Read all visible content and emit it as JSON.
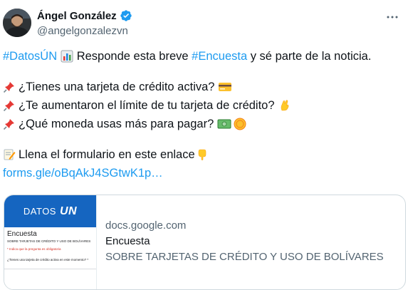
{
  "author": {
    "name": "Ángel González",
    "handle": "@angelgonzalezvn"
  },
  "tweet": {
    "line1": {
      "hashtag1": "#DatosÚN",
      "text_mid": " Responde esta breve ",
      "hashtag2": "#Encuesta",
      "text_end": " y sé parte de la noticia."
    },
    "q1": "¿Tienes una tarjeta de crédito activa?",
    "q2": "¿Te aumentaron el límite de tu tarjeta de crédito?",
    "q3": "¿Qué moneda usas más para pagar?",
    "form_line": "Llena el formulario en este enlace",
    "link": "forms.gle/oBqAkJ4SGtwK1p…"
  },
  "card": {
    "thumb_brand": "DATOS",
    "thumb_brand_logo": "UN",
    "thumb_title": "Encuesta",
    "thumb_subtitle": "SOBRE TARJETAS DE CRÉDITO Y USO DE BOLÍVARES",
    "thumb_required": "* Indica que la pregunta es obligatoria",
    "thumb_question": "¿Tienes una tarjeta de crédito activa en este momento? *",
    "domain": "docs.google.com",
    "title": "Encuesta",
    "description": "SOBRE TARJETAS DE CRÉDITO Y USO DE BOLÍVARES"
  },
  "colors": {
    "link": "#1d9bf0",
    "verified": "#1d9bf0",
    "text": "#0f1419",
    "muted": "#536471"
  },
  "icons": [
    "bar-chart-icon",
    "pushpin-icon",
    "credit-card-icon",
    "crossed-fingers-icon",
    "banknote-icon",
    "coin-icon",
    "memo-icon",
    "pointing-down-icon",
    "more-icon",
    "verified-badge-icon"
  ]
}
